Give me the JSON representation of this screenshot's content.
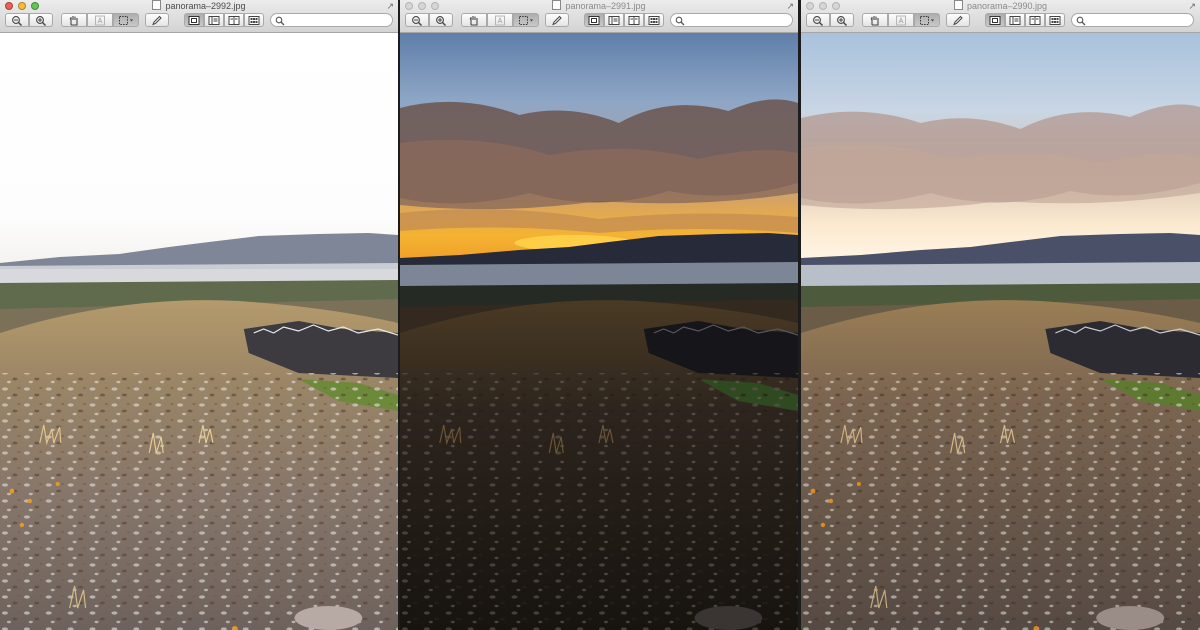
{
  "windows": [
    {
      "title": "panorama–2992.jpg",
      "active": true,
      "exposure": "overexposed",
      "tool_icons": [
        "zoom-out-icon",
        "zoom-in-icon",
        "hand-icon",
        "text-select-icon",
        "rect-select-icon",
        "pencil-icon",
        "single-page-icon",
        "two-page-icon",
        "book-view-icon",
        "contact-sheet-icon",
        "magnifier-icon"
      ]
    },
    {
      "title": "panorama–2991.jpg",
      "active": false,
      "exposure": "underexposed",
      "tool_icons": [
        "zoom-out-icon",
        "zoom-in-icon",
        "hand-icon",
        "text-select-icon",
        "rect-select-icon",
        "pencil-icon",
        "single-page-icon",
        "two-page-icon",
        "book-view-icon",
        "contact-sheet-icon",
        "magnifier-icon"
      ]
    },
    {
      "title": "panorama–2990.jpg",
      "active": false,
      "exposure": "normal",
      "tool_icons": [
        "zoom-out-icon",
        "zoom-in-icon",
        "hand-icon",
        "text-select-icon",
        "rect-select-icon",
        "pencil-icon",
        "single-page-icon",
        "two-page-icon",
        "book-view-icon",
        "contact-sheet-icon",
        "magnifier-icon"
      ]
    }
  ],
  "colors": {
    "close": "#ee5f55",
    "minimize": "#f6bc3a",
    "maximize": "#62c654",
    "sky": "#9bb6d2",
    "sunset": "#f0a93a",
    "lake": "#8c9bab",
    "hill": "#8a7350"
  }
}
